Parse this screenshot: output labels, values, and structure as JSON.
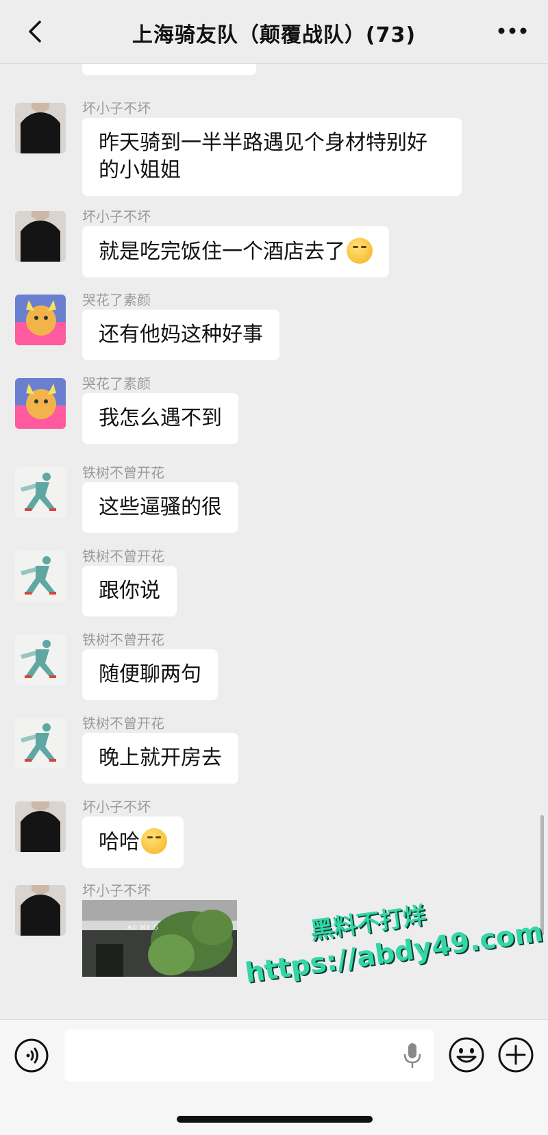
{
  "header": {
    "back_icon": "chevron-left-icon",
    "title": "上海骑友队（颠覆战队）(73)",
    "more_icon": "more-dots-icon"
  },
  "messages": [
    {
      "sender": "坏小子不坏",
      "avatar": "black-shirt-avatar",
      "text": "昨天骑到一半半路遇见个身材特别好的小姐姐"
    },
    {
      "sender": "坏小子不坏",
      "avatar": "black-shirt-avatar",
      "text": "就是吃完饭住一个酒店去了",
      "emoji": "thinking-face-icon"
    },
    {
      "sender": "哭花了素颜",
      "avatar": "cartoon-avatar",
      "text": "还有他妈这种好事"
    },
    {
      "sender": "哭花了素颜",
      "avatar": "cartoon-avatar",
      "text": "我怎么遇不到"
    },
    {
      "sender": "铁树不曾开花",
      "avatar": "runner-avatar",
      "text": "这些逼骚的很"
    },
    {
      "sender": "铁树不曾开花",
      "avatar": "runner-avatar",
      "text": "跟你说"
    },
    {
      "sender": "铁树不曾开花",
      "avatar": "runner-avatar",
      "text": "随便聊两句"
    },
    {
      "sender": "铁树不曾开花",
      "avatar": "runner-avatar",
      "text": "晚上就开房去"
    },
    {
      "sender": "坏小子不坏",
      "avatar": "black-shirt-avatar",
      "text": "哈哈",
      "emoji": "thinking-face-icon"
    },
    {
      "sender": "坏小子不坏",
      "avatar": "black-shirt-avatar",
      "image": "street-photo",
      "photo_sign": "AU MY G"
    }
  ],
  "watermark": {
    "line1": "黑料不打烊",
    "line2": "https://abdy49.com"
  },
  "input": {
    "placeholder": "",
    "voice_icon": "voice-icon",
    "mic_icon": "mic-icon",
    "emoji_icon": "emoji-icon",
    "plus_icon": "plus-icon"
  }
}
